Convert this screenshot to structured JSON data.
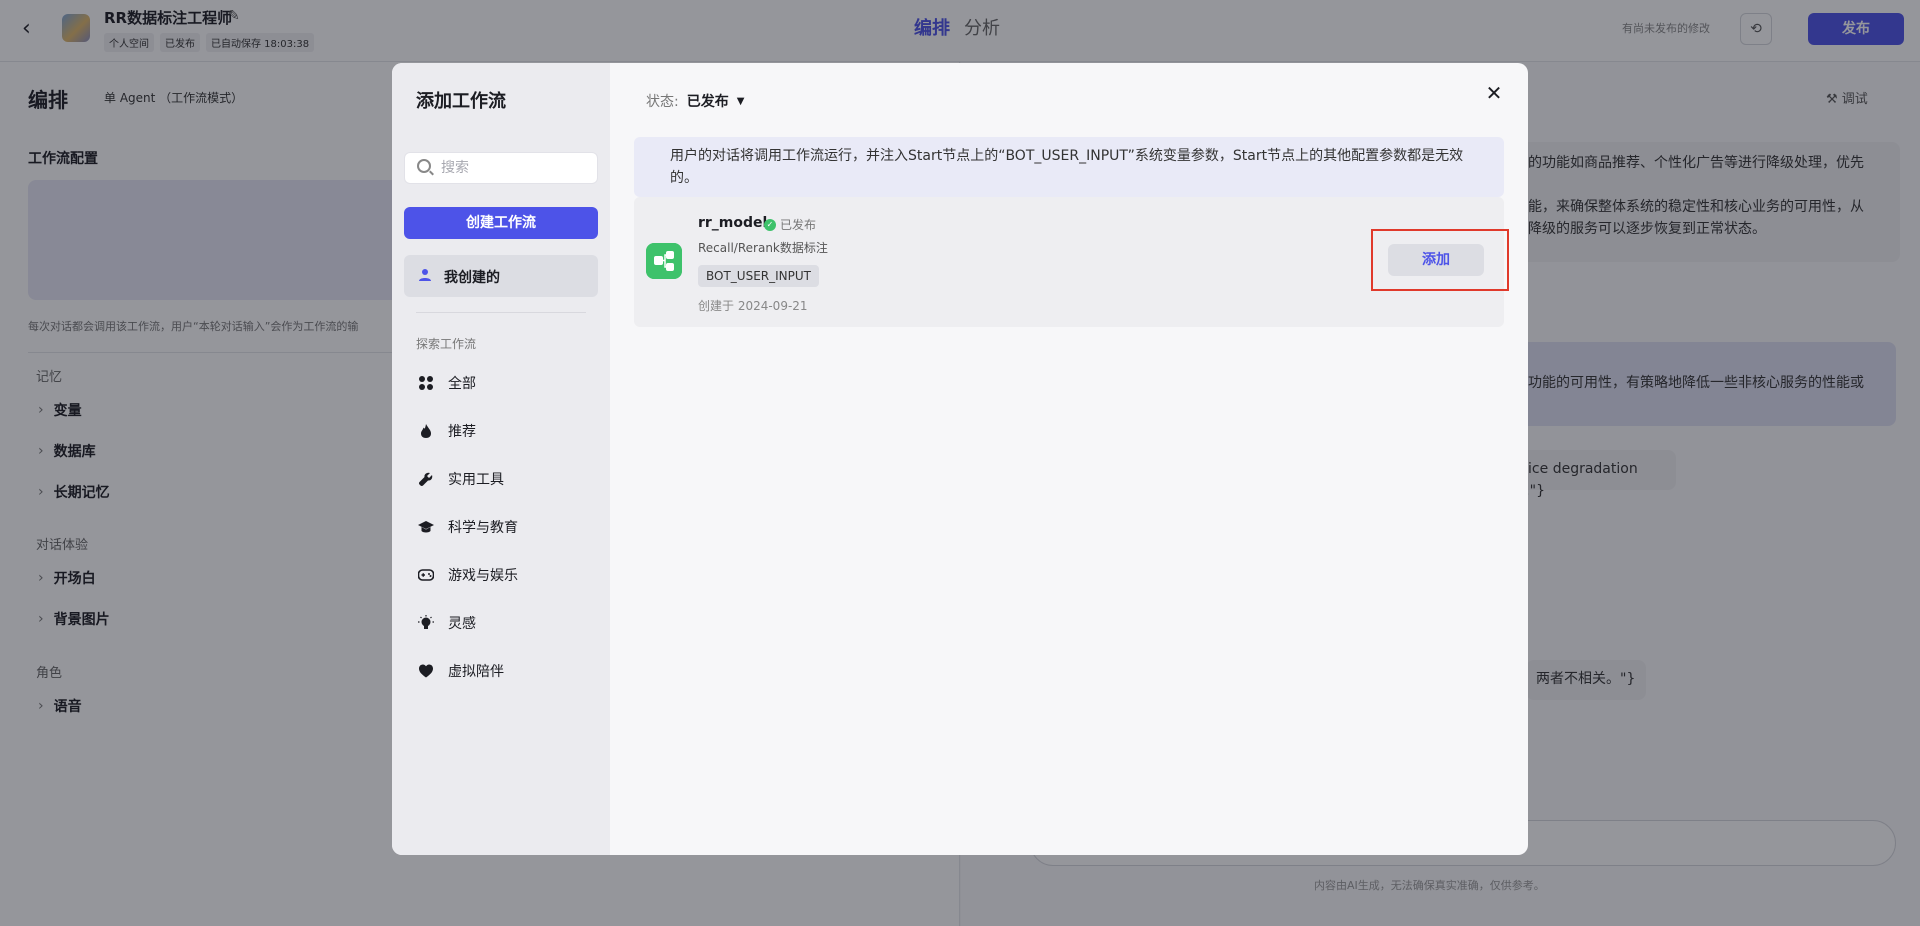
{
  "header": {
    "bot_name": "RR数据标注工程师",
    "meta": [
      "个人空间",
      "已发布",
      "已自动保存 18:03:38"
    ],
    "tabs": [
      "编排",
      "分析"
    ],
    "unpublished_note": "有尚未发布的修改",
    "publish_label": "发布"
  },
  "left_panel": {
    "title": "编排",
    "mode": "单 Agent （工作流模式）",
    "section_workflow": "工作流配置",
    "hint": "每次对话都会调用该工作流，用户“本轮对话输入”会作为工作流的输",
    "groups": [
      {
        "label": "记忆",
        "items": [
          "变量",
          "数据库",
          "长期记忆"
        ]
      },
      {
        "label": "对话体验",
        "items": [
          "开场白",
          "背景图片"
        ]
      },
      {
        "label": "角色",
        "items": [
          "语音"
        ]
      }
    ]
  },
  "right_panel": {
    "debug_label": "调试",
    "bubbles": [
      "建的功能如商品推荐、个性化广告等进行降级处理，优先",
      "功能，来确保整体系统的稳定性和核心业务的可用性，从",
      "被降级的服务可以逐步恢复到正常状态。",
      "心功能的可用性，有策略地降低一些非核心服务的性能或",
      "rvice degradation is.\"}",
      "两者不相关。\"}"
    ],
    "disclaimer": "内容由AI生成，无法确保真实准确，仅供参考。"
  },
  "modal": {
    "title": "添加工作流",
    "search_placeholder": "搜索",
    "create_label": "创建工作流",
    "mine_label": "我创建的",
    "explore_label": "探索工作流",
    "categories": [
      {
        "label": "全部",
        "icon": "grid-icon"
      },
      {
        "label": "推荐",
        "icon": "flame-icon"
      },
      {
        "label": "实用工具",
        "icon": "wrench-icon"
      },
      {
        "label": "科学与教育",
        "icon": "graduation-cap-icon"
      },
      {
        "label": "游戏与娱乐",
        "icon": "gamepad-icon"
      },
      {
        "label": "灵感",
        "icon": "lightbulb-icon"
      },
      {
        "label": "虚拟陪伴",
        "icon": "heart-icon"
      }
    ],
    "status_label": "状态:",
    "status_value": "已发布",
    "notice": "用户的对话将调用工作流运行，并注入Start节点上的“BOT_USER_INPUT”系统变量参数，Start节点上的其他配置参数都是无效的。",
    "workflow": {
      "name": "rr_model",
      "status": "已发布",
      "description": "Recall/Rerank数据标注",
      "tag": "BOT_USER_INPUT",
      "created": "创建于 2024-09-21",
      "add_label": "添加"
    }
  }
}
